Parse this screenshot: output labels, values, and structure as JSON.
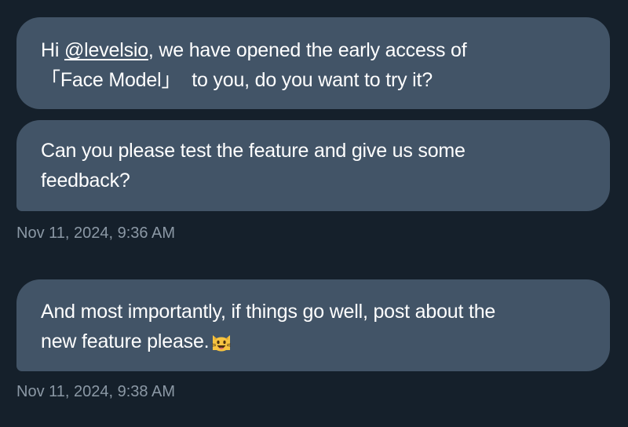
{
  "messages": [
    {
      "greeting": "Hi",
      "mention": "@levelsio",
      "line1_rest": ", we have opened the early access of",
      "bracket_open": "「",
      "bracket_text": "Face Model",
      "bracket_close": "」",
      "line2_rest": "to you, do you want to try it?"
    },
    {
      "line1": "Can you please test the feature and give us some",
      "line2": "feedback?",
      "timestamp": "Nov 11, 2024, 9:36 AM"
    },
    {
      "line1": "And most importantly, if things go well, post about the",
      "line2": "new feature please.",
      "emoji": "smiling-cat-with-open-mouth-icon",
      "timestamp": "Nov 11, 2024, 9:38 AM"
    }
  ],
  "colors": {
    "background": "#15202b",
    "bubble": "#425467",
    "text": "#ffffff",
    "timestamp": "#8b98a5",
    "emoji_face": "#f6c340"
  }
}
